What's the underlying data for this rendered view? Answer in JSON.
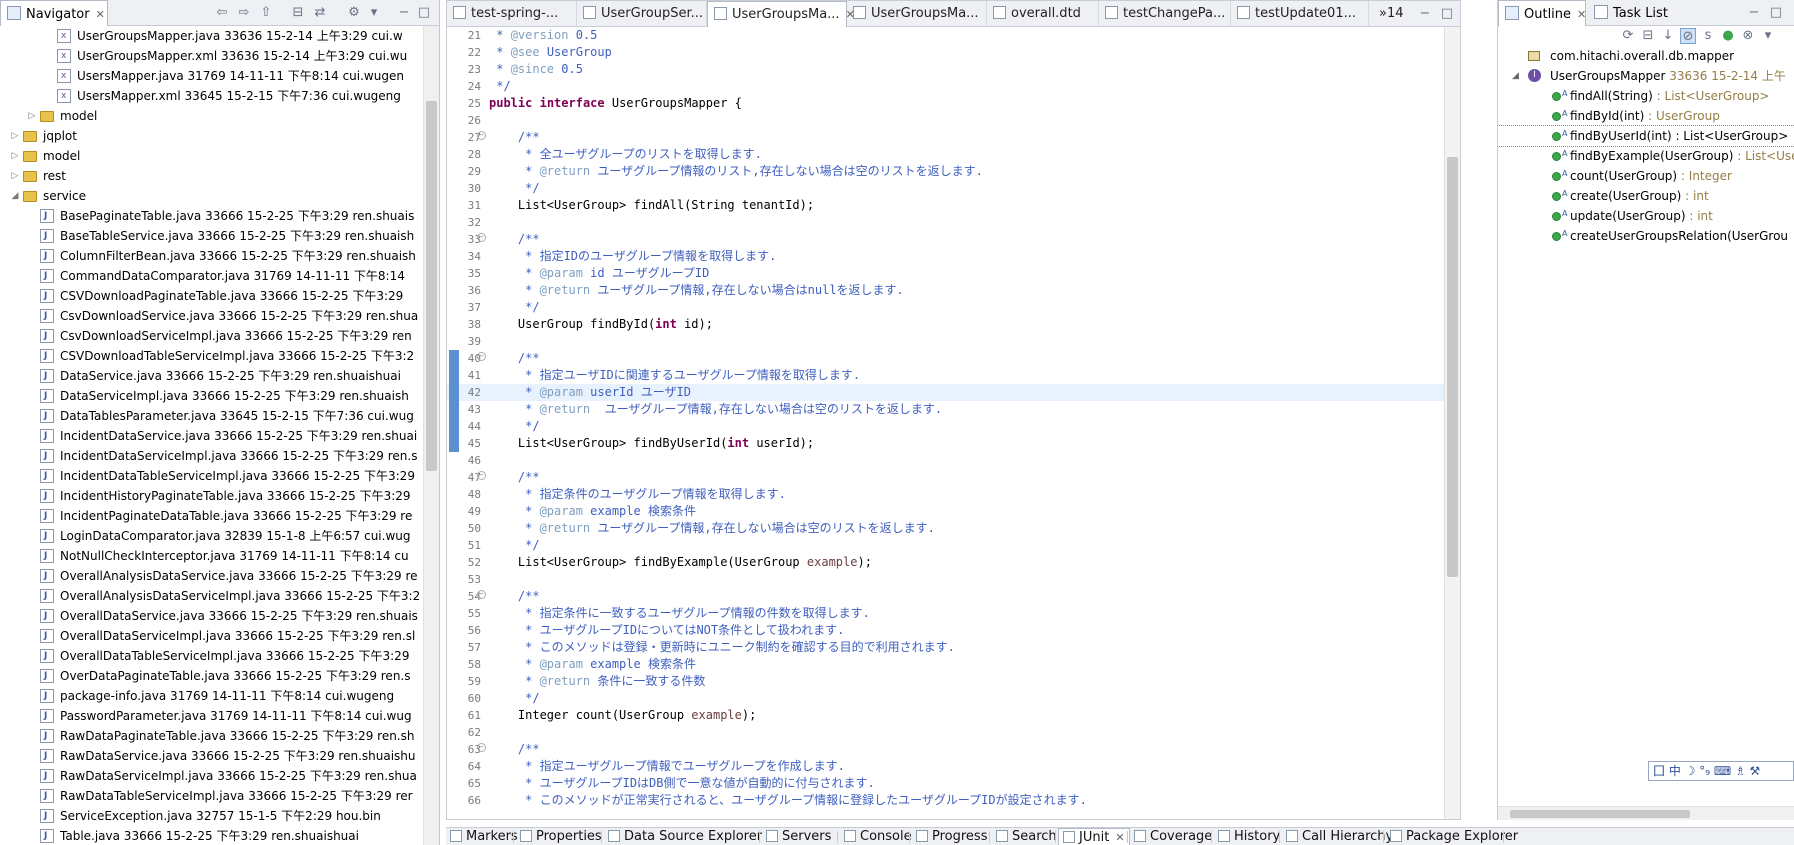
{
  "navigator": {
    "tab_label": "Navigator",
    "tree": [
      {
        "indent": 3,
        "kind": "xml",
        "label": "UserGroupsMapper.java 33636  15-2-14 上午3:29  cui.w"
      },
      {
        "indent": 3,
        "kind": "xml",
        "label": "UserGroupsMapper.xml 33636  15-2-14 上午3:29  cui.wu"
      },
      {
        "indent": 3,
        "kind": "xml",
        "label": "UsersMapper.java 31769  14-11-11 下午8:14  cui.wugen"
      },
      {
        "indent": 3,
        "kind": "xml",
        "label": "UsersMapper.xml 33645  15-2-15 下午7:36  cui.wugeng"
      },
      {
        "indent": 2,
        "kind": "folder",
        "twisty": "▷",
        "label": "model"
      },
      {
        "indent": 1,
        "kind": "folder",
        "twisty": "▷",
        "label": "jqplot"
      },
      {
        "indent": 1,
        "kind": "folder",
        "twisty": "▷",
        "label": "model"
      },
      {
        "indent": 1,
        "kind": "folder",
        "twisty": "▷",
        "label": "rest"
      },
      {
        "indent": 1,
        "kind": "folder",
        "twisty": "◢",
        "label": "service"
      },
      {
        "indent": 2,
        "kind": "java",
        "label": "BasePaginateTable.java 33666  15-2-25 下午3:29  ren.shuais"
      },
      {
        "indent": 2,
        "kind": "java",
        "label": "BaseTableService.java 33666  15-2-25 下午3:29  ren.shuaish"
      },
      {
        "indent": 2,
        "kind": "java",
        "label": "ColumnFilterBean.java 33666  15-2-25 下午3:29  ren.shuaish"
      },
      {
        "indent": 2,
        "kind": "java",
        "label": "CommandDataComparator.java 31769  14-11-11 下午8:14"
      },
      {
        "indent": 2,
        "kind": "java",
        "label": "CSVDownloadPaginateTable.java 33666  15-2-25 下午3:29"
      },
      {
        "indent": 2,
        "kind": "java",
        "label": "CsvDownloadService.java 33666  15-2-25 下午3:29  ren.shua"
      },
      {
        "indent": 2,
        "kind": "java",
        "label": "CsvDownloadServiceImpl.java 33666  15-2-25 下午3:29  ren"
      },
      {
        "indent": 2,
        "kind": "java",
        "label": "CSVDownloadTableServiceImpl.java 33666  15-2-25 下午3:2"
      },
      {
        "indent": 2,
        "kind": "java",
        "label": "DataService.java 33666  15-2-25 下午3:29  ren.shuaishuai"
      },
      {
        "indent": 2,
        "kind": "java",
        "label": "DataServiceImpl.java 33666  15-2-25 下午3:29  ren.shuaish"
      },
      {
        "indent": 2,
        "kind": "java",
        "label": "DataTablesParameter.java 33645  15-2-15 下午7:36  cui.wug"
      },
      {
        "indent": 2,
        "kind": "java",
        "label": "IncidentDataService.java 33666  15-2-25 下午3:29  ren.shuai"
      },
      {
        "indent": 2,
        "kind": "java",
        "label": "IncidentDataServiceImpl.java 33666  15-2-25 下午3:29  ren.s"
      },
      {
        "indent": 2,
        "kind": "java",
        "label": "IncidentDataTableServiceImpl.java 33666  15-2-25 下午3:29"
      },
      {
        "indent": 2,
        "kind": "java",
        "label": "IncidentHistoryPaginateTable.java 33666  15-2-25 下午3:29"
      },
      {
        "indent": 2,
        "kind": "java",
        "label": "IncidentPaginateDataTable.java 33666  15-2-25 下午3:29  re"
      },
      {
        "indent": 2,
        "kind": "java",
        "label": "LoginDataComparator.java 32839  15-1-8 上午6:57  cui.wug"
      },
      {
        "indent": 2,
        "kind": "java",
        "label": "NotNullCheckInterceptor.java 31769  14-11-11 下午8:14  cu"
      },
      {
        "indent": 2,
        "kind": "java",
        "label": "OverallAnalysisDataService.java 33666  15-2-25 下午3:29  re"
      },
      {
        "indent": 2,
        "kind": "java",
        "label": "OverallAnalysisDataServiceImpl.java 33666  15-2-25 下午3:2"
      },
      {
        "indent": 2,
        "kind": "java",
        "label": "OverallDataService.java 33666  15-2-25 下午3:29  ren.shuais"
      },
      {
        "indent": 2,
        "kind": "java",
        "label": "OverallDataServiceImpl.java 33666  15-2-25 下午3:29  ren.sl"
      },
      {
        "indent": 2,
        "kind": "java",
        "label": "OverallDataTableServiceImpl.java 33666  15-2-25 下午3:29"
      },
      {
        "indent": 2,
        "kind": "java",
        "label": "OverDataPaginateTable.java 33666  15-2-25 下午3:29  ren.s"
      },
      {
        "indent": 2,
        "kind": "java",
        "label": "package-info.java 31769  14-11-11 下午8:14  cui.wugeng"
      },
      {
        "indent": 2,
        "kind": "java",
        "label": "PasswordParameter.java 31769  14-11-11 下午8:14  cui.wug"
      },
      {
        "indent": 2,
        "kind": "java",
        "label": "RawDataPaginateTable.java 33666  15-2-25 下午3:29  ren.sh"
      },
      {
        "indent": 2,
        "kind": "java",
        "label": "RawDataService.java 33666  15-2-25 下午3:29  ren.shuaishu"
      },
      {
        "indent": 2,
        "kind": "java",
        "label": "RawDataServiceImpl.java 33666  15-2-25 下午3:29  ren.shua"
      },
      {
        "indent": 2,
        "kind": "java",
        "label": "RawDataTableServiceImpl.java 33666  15-2-25 下午3:29  rer"
      },
      {
        "indent": 2,
        "kind": "java",
        "label": "ServiceException.java 32757  15-1-5 下午2:29  hou.bin"
      },
      {
        "indent": 2,
        "kind": "java",
        "label": "Table.java 33666  15-2-25 下午3:29  ren.shuaishuai"
      }
    ]
  },
  "editor": {
    "tabs": [
      {
        "label": "test-spring-..."
      },
      {
        "label": "UserGroupSer..."
      },
      {
        "label": "UserGroupsMa...",
        "active": true
      },
      {
        "label": "UserGroupsMa..."
      },
      {
        "label": "overall.dtd"
      },
      {
        "label": "testChangePa..."
      },
      {
        "label": "testUpdate01..."
      }
    ],
    "overflow_label": "»14",
    "lines": [
      {
        "n": "21",
        "html": "<span class='c-comment'> * </span><span class='c-tag'>@version</span><span class='c-comment'> 0.5</span>"
      },
      {
        "n": "22",
        "html": "<span class='c-comment'> * </span><span class='c-tag'>@see</span><span class='c-comment'> UserGroup</span>"
      },
      {
        "n": "23",
        "html": "<span class='c-comment'> * </span><span class='c-tag'>@since</span><span class='c-comment'> 0.5</span>"
      },
      {
        "n": "24",
        "html": "<span class='c-comment'> */</span>"
      },
      {
        "n": "25",
        "html": "<span class='c-kw'>public</span> <span class='c-kw'>interface</span> UserGroupsMapper {"
      },
      {
        "n": "26",
        "html": ""
      },
      {
        "n": "27",
        "fold": true,
        "html": "    <span class='c-comment'>/**</span>"
      },
      {
        "n": "28",
        "html": "<span class='c-comment'>     * 全ユーザグループのリストを取得します.</span>"
      },
      {
        "n": "29",
        "html": "<span class='c-comment'>     * </span><span class='c-tag'>@return</span><span class='c-comment'> ユーザグループ情報のリスト,存在しない場合は空のリストを返します.</span>"
      },
      {
        "n": "30",
        "html": "<span class='c-comment'>     */</span>"
      },
      {
        "n": "31",
        "html": "    List&lt;UserGroup&gt; findAll(String tenantId);"
      },
      {
        "n": "32",
        "html": ""
      },
      {
        "n": "33",
        "fold": true,
        "html": "    <span class='c-comment'>/**</span>"
      },
      {
        "n": "34",
        "html": "<span class='c-comment'>     * 指定IDのユーザグループ情報を取得します.</span>"
      },
      {
        "n": "35",
        "html": "<span class='c-comment'>     * </span><span class='c-tag'>@param</span><span class='c-comment'> id ユーザグループID</span>"
      },
      {
        "n": "36",
        "html": "<span class='c-comment'>     * </span><span class='c-tag'>@return</span><span class='c-comment'> ユーザグループ情報,存在しない場合はnullを返します.</span>"
      },
      {
        "n": "37",
        "html": "<span class='c-comment'>     */</span>"
      },
      {
        "n": "38",
        "html": "    UserGroup findById(<span class='c-kw'>int</span> id);"
      },
      {
        "n": "39",
        "html": ""
      },
      {
        "n": "40",
        "fold": true,
        "changed": true,
        "html": "    <span class='c-comment'>/**</span>"
      },
      {
        "n": "41",
        "changed": true,
        "html": "<span class='c-comment'>     * 指定ユーザIDに関連するユーザグループ情報を取得します.</span>"
      },
      {
        "n": "42",
        "changed": true,
        "current": true,
        "html": "<span class='c-comment'>     * </span><span class='c-tag'>@param</span><span class='c-comment'> userId ユーザID</span>"
      },
      {
        "n": "43",
        "changed": true,
        "html": "<span class='c-comment'>     * </span><span class='c-tag'>@return</span><span class='c-comment'>  ユーザグループ情報,存在しない場合は空のリストを返します.</span>"
      },
      {
        "n": "44",
        "changed": true,
        "html": "<span class='c-comment'>     */</span>"
      },
      {
        "n": "45",
        "changed": true,
        "html": "    List&lt;UserGroup&gt; findByUserId(<span class='c-kw'>int</span> userId);"
      },
      {
        "n": "46",
        "html": ""
      },
      {
        "n": "47",
        "fold": true,
        "html": "    <span class='c-comment'>/**</span>"
      },
      {
        "n": "48",
        "html": "<span class='c-comment'>     * 指定条件のユーザグループ情報を取得します.</span>"
      },
      {
        "n": "49",
        "html": "<span class='c-comment'>     * </span><span class='c-tag'>@param</span><span class='c-comment'> example 検索条件</span>"
      },
      {
        "n": "50",
        "html": "<span class='c-comment'>     * </span><span class='c-tag'>@return</span><span class='c-comment'> ユーザグループ情報,存在しない場合は空のリストを返します.</span>"
      },
      {
        "n": "51",
        "html": "<span class='c-comment'>     */</span>"
      },
      {
        "n": "52",
        "html": "    List&lt;UserGroup&gt; findByExample(UserGroup <span class='c-param'>example</span>);"
      },
      {
        "n": "53",
        "html": ""
      },
      {
        "n": "54",
        "fold": true,
        "html": "    <span class='c-comment'>/**</span>"
      },
      {
        "n": "55",
        "html": "<span class='c-comment'>     * 指定条件に一致するユーザグループ情報の件数を取得します.</span>"
      },
      {
        "n": "56",
        "html": "<span class='c-comment'>     * ユーザグループIDについてはNOT条件として扱われます.</span>"
      },
      {
        "n": "57",
        "html": "<span class='c-comment'>     * このメソッドは登録・更新時にユニーク制約を確認する目的で利用されます.</span>"
      },
      {
        "n": "58",
        "html": "<span class='c-comment'>     * </span><span class='c-tag'>@param</span><span class='c-comment'> example 検索条件</span>"
      },
      {
        "n": "59",
        "html": "<span class='c-comment'>     * </span><span class='c-tag'>@return</span><span class='c-comment'> 条件に一致する件数</span>"
      },
      {
        "n": "60",
        "html": "<span class='c-comment'>     */</span>"
      },
      {
        "n": "61",
        "html": "    Integer count(UserGroup <span class='c-param'>example</span>);"
      },
      {
        "n": "62",
        "html": ""
      },
      {
        "n": "63",
        "fold": true,
        "html": "    <span class='c-comment'>/**</span>"
      },
      {
        "n": "64",
        "html": "<span class='c-comment'>     * 指定ユーザグループ情報でユーザグループを作成します.</span>"
      },
      {
        "n": "65",
        "html": "<span class='c-comment'>     * ユーザグループIDはDB側で一意な値が自動的に付与されます.</span>"
      },
      {
        "n": "66",
        "html": "<span class='c-comment'>     * このメソッドが正常実行されると、ユーザグループ情報に登録したユーザグループIDが設定されます.</span>"
      }
    ]
  },
  "outline": {
    "tab_label": "Outline",
    "tasklist_label": "Task List",
    "package": "com.hitachi.overall.db.mapper",
    "interface": "UserGroupsMapper",
    "interface_meta": "33636  15-2-14 上午",
    "methods": [
      {
        "sig": "findAll(String)",
        "ret": " : List<UserGroup>"
      },
      {
        "sig": "findById(int)",
        "ret": " : UserGroup"
      },
      {
        "sig": "findByUserId(int) : List<UserGroup>",
        "ret": "",
        "selected": true
      },
      {
        "sig": "findByExample(UserGroup)",
        "ret": " : List<Use"
      },
      {
        "sig": "count(UserGroup)",
        "ret": " : Integer"
      },
      {
        "sig": "create(UserGroup)",
        "ret": " : int"
      },
      {
        "sig": "update(UserGroup)",
        "ret": " : int"
      },
      {
        "sig": "createUserGroupsRelation(UserGrou",
        "ret": ""
      }
    ]
  },
  "ime": {
    "label": "囗 中 ☽ °₉ ⌨ ♗ ⚒"
  },
  "bottom_tabs": [
    {
      "label": "Markers"
    },
    {
      "label": "Properties"
    },
    {
      "label": "Data Source Explorer"
    },
    {
      "label": "Servers"
    },
    {
      "label": "Console"
    },
    {
      "label": "Progress"
    },
    {
      "label": "Search"
    },
    {
      "label": "JUnit",
      "active": true
    },
    {
      "label": "Coverage"
    },
    {
      "label": "History"
    },
    {
      "label": "Call Hierarchy"
    },
    {
      "label": "Package Explorer"
    }
  ]
}
